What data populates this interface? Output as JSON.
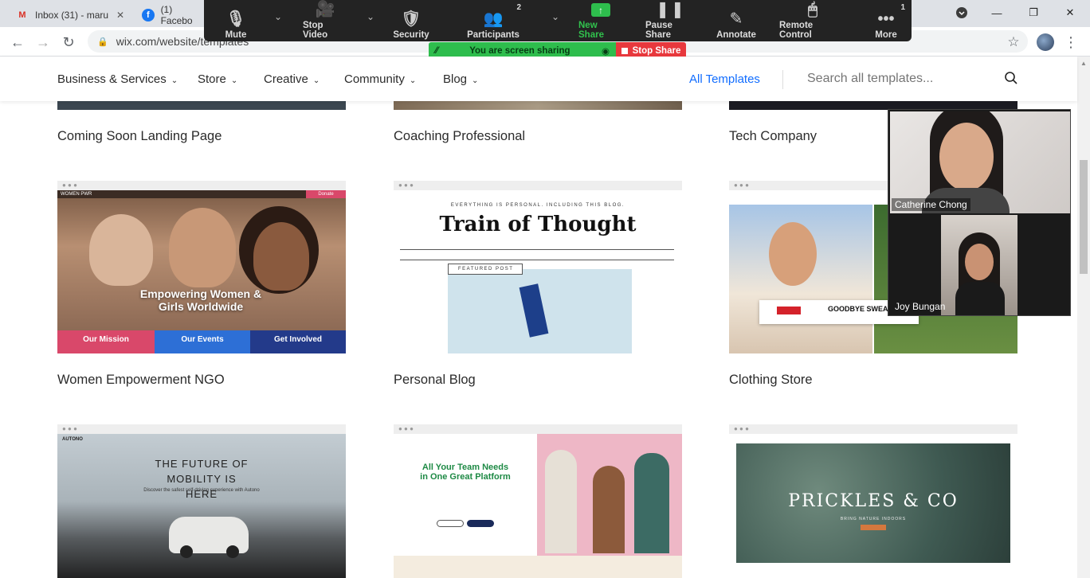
{
  "browser": {
    "tabs": [
      {
        "label": "Inbox (31) - maru",
        "icon": "gmail-icon"
      },
      {
        "label": "(1) Facebo",
        "icon": "facebook-icon"
      }
    ],
    "url": "wix.com/website/templates"
  },
  "zoom": {
    "buttons": {
      "mute": "Mute",
      "stop_video": "Stop Video",
      "security": "Security",
      "participants": "Participants",
      "participants_count": "2",
      "new_share": "New Share",
      "pause_share": "Pause Share",
      "annotate": "Annotate",
      "remote_control": "Remote Control",
      "more": "More",
      "more_count": "1"
    },
    "sharing_status": "You are screen sharing",
    "stop_share": "Stop Share",
    "participants": [
      {
        "name": "Catherine Chong"
      },
      {
        "name": "Joy Bungan"
      }
    ]
  },
  "wix": {
    "nav": [
      {
        "label": "Business & Services"
      },
      {
        "label": "Store"
      },
      {
        "label": "Creative"
      },
      {
        "label": "Community"
      },
      {
        "label": "Blog"
      }
    ],
    "all_templates": "All Templates",
    "search_placeholder": "Search all templates...",
    "cards": [
      {
        "title": "Coming Soon Landing Page"
      },
      {
        "title": "Coaching Professional"
      },
      {
        "title": "Tech Company"
      },
      {
        "title": "Women Empowerment NGO"
      },
      {
        "title": "Personal Blog"
      },
      {
        "title": "Clothing Store"
      },
      {
        "title": ""
      },
      {
        "title": ""
      },
      {
        "title": ""
      }
    ],
    "ngo_thumb": {
      "brand": "WOMEN PWR",
      "donate": "Donate",
      "headline": "Empowering Women & Girls Worldwide",
      "tiles": [
        "Our Mission",
        "Our Events",
        "Get Involved"
      ]
    },
    "blog_thumb": {
      "kicker": "EVERYTHING IS PERSONAL. INCLUDING THIS BLOG.",
      "title": "Train of Thought",
      "featured": "FEATURED POST"
    },
    "clothing_thumb": {
      "tag": "GOODBYE SWEATS, HE"
    },
    "auto_thumb": {
      "headline": "THE FUTURE OF MOBILITY IS HERE",
      "sub": "Discover the safest self-driving experience with Autono",
      "brand": "AUTONO"
    },
    "team_thumb": {
      "headline": "All Your Team Needs in One Great Platform"
    },
    "prickles_thumb": {
      "title": "PRICKLES & CO",
      "sub": "BRING NATURE INDOORS"
    }
  }
}
